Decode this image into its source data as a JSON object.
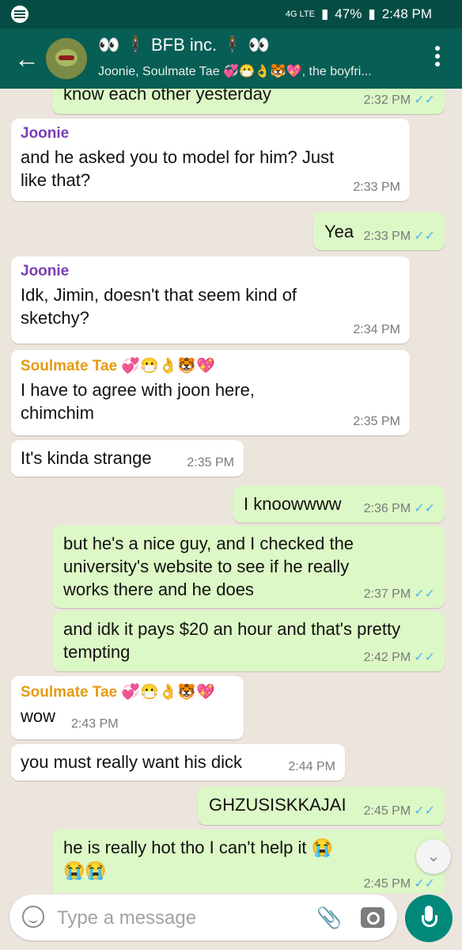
{
  "status": {
    "battery": "47%",
    "time": "2:48 PM",
    "network": "4G LTE"
  },
  "header": {
    "title": "👀 🕴 BFB inc. 🕴 👀",
    "subtitle": "Joonie, Soulmate Tae 💞😷👌🐯💖, the boyfri..."
  },
  "messages": [
    {
      "dir": "out",
      "text": "know each other yesterday",
      "time": "2:32 PM",
      "ticks": "✓✓"
    },
    {
      "dir": "in",
      "sender": "Joonie",
      "text": "and he asked you to model for him? Just\nlike that?",
      "time": "2:33 PM"
    },
    {
      "dir": "out",
      "text": "Yea",
      "time": "2:33 PM",
      "ticks": "✓✓"
    },
    {
      "dir": "in",
      "sender": "Joonie",
      "text": "Idk, Jimin, doesn't that seem kind of\nsketchy?",
      "time": "2:34 PM"
    },
    {
      "dir": "in",
      "sender": "Soulmate Tae 💞😷👌🐯💖",
      "text": "I have to agree with joon here,\nchimchim",
      "time": "2:35 PM"
    },
    {
      "dir": "in",
      "text": "It's kinda strange",
      "time": "2:35 PM"
    },
    {
      "dir": "out",
      "text": "I knoowwww",
      "time": "2:36 PM",
      "ticks": "✓✓"
    },
    {
      "dir": "out",
      "text": "but he's a nice guy, and I checked the\nuniversity's website to see if he really\nworks there and he does",
      "time": "2:37 PM",
      "ticks": "✓✓"
    },
    {
      "dir": "out",
      "text": "and idk it pays $20 an hour and that's pretty\ntempting",
      "time": "2:42 PM",
      "ticks": "✓✓"
    },
    {
      "dir": "in",
      "sender": "Soulmate Tae 💞😷👌🐯💖",
      "text": "wow",
      "time": "2:43 PM"
    },
    {
      "dir": "in",
      "text": "you must really want his dick",
      "time": "2:44 PM"
    },
    {
      "dir": "out",
      "text": "GHZUSISKKAJAI",
      "time": "2:45 PM",
      "ticks": "✓✓"
    },
    {
      "dir": "out",
      "text": "he is really hot tho I can't help it 😭\n😭😭",
      "time": "2:45 PM",
      "ticks": "✓✓"
    }
  ],
  "colors": {
    "joonie": "#7b3fb3",
    "tae": "#e69a12"
  },
  "composer": {
    "placeholder": "Type a message"
  }
}
